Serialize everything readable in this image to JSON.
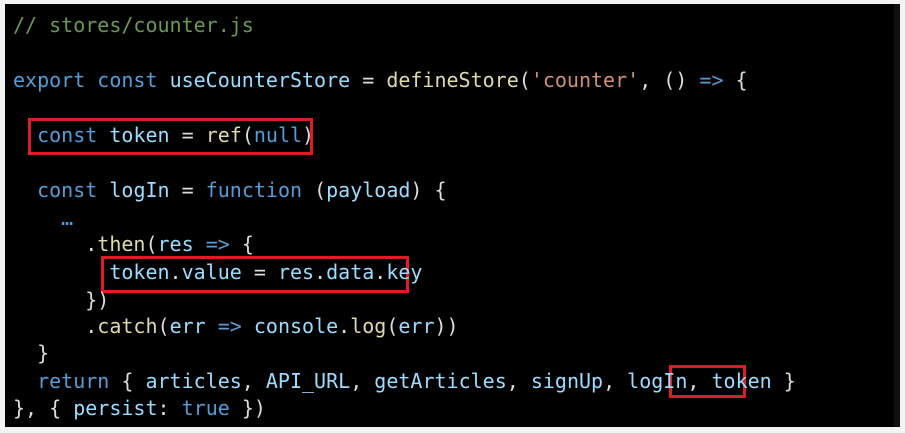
{
  "editor": {
    "language": "javascript",
    "lines": [
      {
        "tokens": [
          {
            "t": "// stores/counter.js",
            "c": "comment"
          }
        ]
      },
      {
        "tokens": []
      },
      {
        "tokens": [
          {
            "t": "export",
            "c": "keyword"
          },
          {
            "t": " ",
            "c": "plain"
          },
          {
            "t": "const",
            "c": "keyword"
          },
          {
            "t": " ",
            "c": "plain"
          },
          {
            "t": "useCounterStore",
            "c": "variable"
          },
          {
            "t": " = ",
            "c": "plain"
          },
          {
            "t": "defineStore",
            "c": "function"
          },
          {
            "t": "(",
            "c": "punct"
          },
          {
            "t": "'counter'",
            "c": "string"
          },
          {
            "t": ", () ",
            "c": "plain"
          },
          {
            "t": "=>",
            "c": "arrow"
          },
          {
            "t": " {",
            "c": "plain"
          }
        ]
      },
      {
        "tokens": []
      },
      {
        "tokens": [
          {
            "t": "  ",
            "c": "plain"
          },
          {
            "t": "const",
            "c": "keyword"
          },
          {
            "t": " ",
            "c": "plain"
          },
          {
            "t": "token",
            "c": "variable"
          },
          {
            "t": " = ",
            "c": "plain"
          },
          {
            "t": "ref",
            "c": "function"
          },
          {
            "t": "(",
            "c": "punct"
          },
          {
            "t": "null",
            "c": "null"
          },
          {
            "t": ")",
            "c": "punct"
          }
        ]
      },
      {
        "tokens": []
      },
      {
        "tokens": [
          {
            "t": "  ",
            "c": "plain"
          },
          {
            "t": "const",
            "c": "keyword"
          },
          {
            "t": " ",
            "c": "plain"
          },
          {
            "t": "logIn",
            "c": "variable"
          },
          {
            "t": " = ",
            "c": "plain"
          },
          {
            "t": "function",
            "c": "keyword"
          },
          {
            "t": " (",
            "c": "plain"
          },
          {
            "t": "payload",
            "c": "variable"
          },
          {
            "t": ") {",
            "c": "plain"
          }
        ]
      },
      {
        "tokens": [
          {
            "t": "    …",
            "c": "keyword"
          }
        ]
      },
      {
        "tokens": [
          {
            "t": "      .",
            "c": "plain"
          },
          {
            "t": "then",
            "c": "function"
          },
          {
            "t": "(",
            "c": "punct"
          },
          {
            "t": "res",
            "c": "variable"
          },
          {
            "t": " ",
            "c": "plain"
          },
          {
            "t": "=>",
            "c": "arrow"
          },
          {
            "t": " {",
            "c": "plain"
          }
        ]
      },
      {
        "tokens": [
          {
            "t": "        ",
            "c": "plain"
          },
          {
            "t": "token",
            "c": "variable"
          },
          {
            "t": ".",
            "c": "plain"
          },
          {
            "t": "value",
            "c": "property"
          },
          {
            "t": " = ",
            "c": "plain"
          },
          {
            "t": "res",
            "c": "variable"
          },
          {
            "t": ".",
            "c": "plain"
          },
          {
            "t": "data",
            "c": "property"
          },
          {
            "t": ".",
            "c": "plain"
          },
          {
            "t": "key",
            "c": "property"
          }
        ]
      },
      {
        "tokens": [
          {
            "t": "      })",
            "c": "plain"
          }
        ]
      },
      {
        "tokens": [
          {
            "t": "      .",
            "c": "plain"
          },
          {
            "t": "catch",
            "c": "function"
          },
          {
            "t": "(",
            "c": "punct"
          },
          {
            "t": "err",
            "c": "variable"
          },
          {
            "t": " ",
            "c": "plain"
          },
          {
            "t": "=>",
            "c": "arrow"
          },
          {
            "t": " ",
            "c": "plain"
          },
          {
            "t": "console",
            "c": "variable"
          },
          {
            "t": ".",
            "c": "plain"
          },
          {
            "t": "log",
            "c": "function"
          },
          {
            "t": "(",
            "c": "punct"
          },
          {
            "t": "err",
            "c": "variable"
          },
          {
            "t": "))",
            "c": "punct"
          }
        ]
      },
      {
        "tokens": [
          {
            "t": "  }",
            "c": "plain"
          }
        ]
      },
      {
        "tokens": [
          {
            "t": "  ",
            "c": "plain"
          },
          {
            "t": "return",
            "c": "keyword"
          },
          {
            "t": " { ",
            "c": "plain"
          },
          {
            "t": "articles",
            "c": "variable"
          },
          {
            "t": ", ",
            "c": "plain"
          },
          {
            "t": "API_URL",
            "c": "variable"
          },
          {
            "t": ", ",
            "c": "plain"
          },
          {
            "t": "getArticles",
            "c": "variable"
          },
          {
            "t": ", ",
            "c": "plain"
          },
          {
            "t": "signUp",
            "c": "variable"
          },
          {
            "t": ", ",
            "c": "plain"
          },
          {
            "t": "logIn",
            "c": "variable"
          },
          {
            "t": ", ",
            "c": "plain"
          },
          {
            "t": "token",
            "c": "variable"
          },
          {
            "t": " }",
            "c": "plain"
          }
        ]
      },
      {
        "tokens": [
          {
            "t": "}, { ",
            "c": "plain"
          },
          {
            "t": "persist",
            "c": "property"
          },
          {
            "t": ": ",
            "c": "plain"
          },
          {
            "t": "true",
            "c": "keyword"
          },
          {
            "t": " })",
            "c": "plain"
          }
        ]
      }
    ]
  },
  "annotations": {
    "color": "#e01b24",
    "highlights": [
      {
        "label": "const token = ref(null)"
      },
      {
        "label": "token.value = res.data.key"
      },
      {
        "label": "token"
      }
    ]
  },
  "theme": {
    "background": "#000000",
    "comment": "#6a9955",
    "keyword": "#569cd6",
    "function": "#dcdcaa",
    "variable": "#9cdcfe",
    "string": "#ce9178",
    "plain": "#dcdcdc"
  }
}
